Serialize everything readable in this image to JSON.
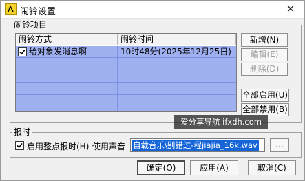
{
  "window": {
    "title": "闹铃设置",
    "close_glyph": "✕"
  },
  "alarm_group": {
    "label": "闹铃项目",
    "columns": [
      "闹铃方式",
      "闹铃时间"
    ],
    "rows": [
      {
        "checked": true,
        "method": "给对象发消息啊",
        "time": "10时48分(2025年12月25日)"
      }
    ]
  },
  "side_buttons": {
    "add": "新增(N)",
    "edit": "编辑(E)",
    "delete": "删除(D)",
    "enable_all": "全部启用(U)",
    "disable_all": "全部禁用(B)"
  },
  "overlay": {
    "text": "爱分享导航 ifxdh.com"
  },
  "chime_group": {
    "label": "报时",
    "enable_label": "启用整点报时(H)",
    "enable_checked": true,
    "sound_label": "使用声音",
    "sound_value": "自载音乐\\别错过-程jiajia_16k.wav",
    "browse_label": "..."
  },
  "footer": {
    "ok": "确定(O)",
    "apply": "应用(A)",
    "cancel": "取消(C)"
  },
  "colors": {
    "selection": "#9fb0f0",
    "field_selection": "#1665d8"
  }
}
